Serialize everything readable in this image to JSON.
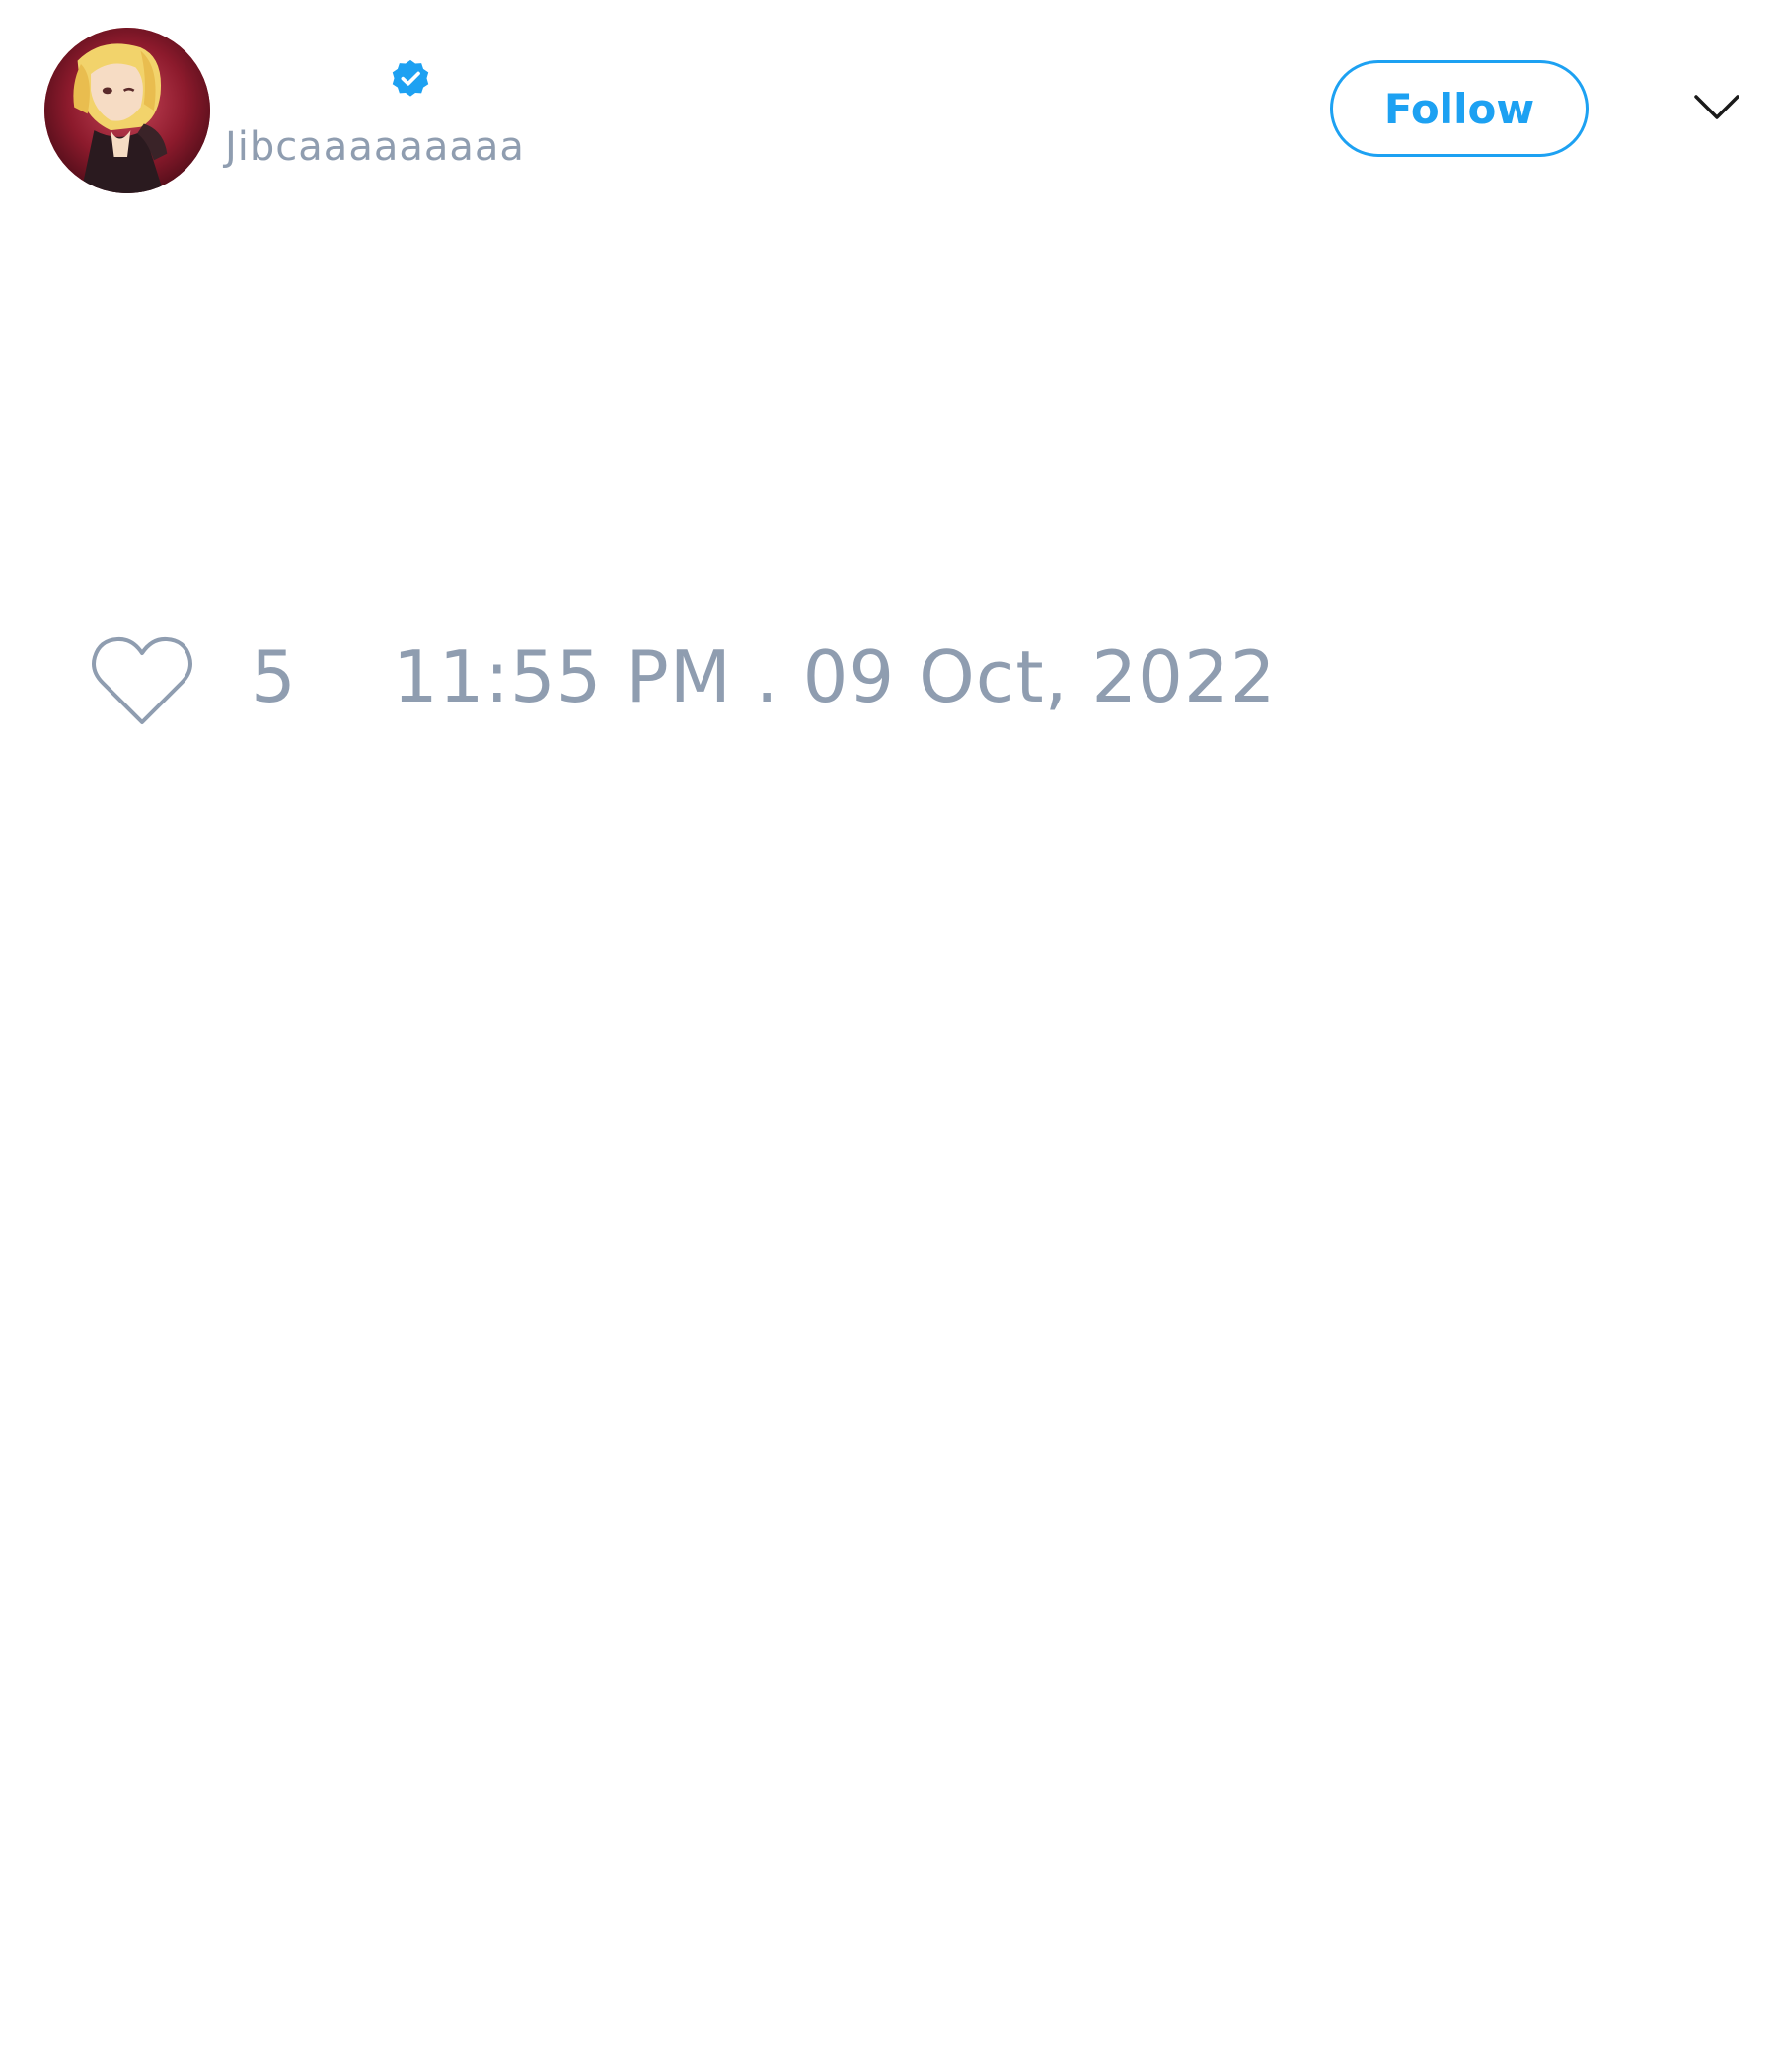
{
  "tweet": {
    "author": {
      "handle": "Jibcaaaaaaaaa",
      "verified": true,
      "avatar_icon": "anime-character-avatar"
    },
    "follow_button": {
      "label": "Follow"
    },
    "more_menu_icon": "chevron-down-icon",
    "likes": {
      "icon": "heart-outline-icon",
      "count": "5"
    },
    "timestamp": "11:55 PM . 09 Oct, 2022"
  },
  "colors": {
    "accent": "#1da1f2",
    "muted_text": "#8f9db0",
    "background": "#ffffff"
  }
}
